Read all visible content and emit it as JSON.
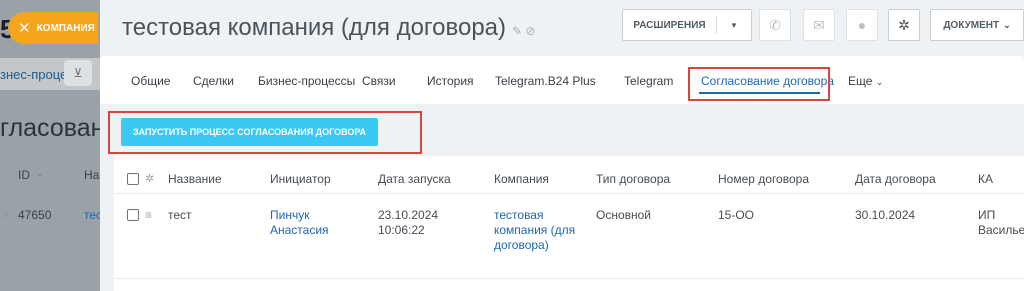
{
  "background": {
    "logo_num": "5",
    "company_chip": "КОМПАНИЯ",
    "process_label": "знес-процесс",
    "heading": "гласование",
    "table_head_id": "ID",
    "table_head_name": "На",
    "row_id": "47650",
    "row_name": "тес"
  },
  "header": {
    "title": "тестовая компания (для договора)",
    "extensions_label": "РАСШИРЕНИЯ",
    "document_label": "ДОКУМЕНТ"
  },
  "tabs": [
    {
      "label": "Общие"
    },
    {
      "label": "Сделки"
    },
    {
      "label": "Бизнес-процессы"
    },
    {
      "label": "Связи"
    },
    {
      "label": "История"
    },
    {
      "label": "Telegram.B24 Plus"
    },
    {
      "label": "Telegram"
    },
    {
      "label": "Согласование договора"
    },
    {
      "label": "Еще"
    }
  ],
  "actions": {
    "start_process": "ЗАПУСТИТЬ ПРОЦЕСС СОГЛАСОВАНИЯ ДОГОВОРА"
  },
  "table": {
    "columns": [
      "Название",
      "Инициатор",
      "Дата запуска",
      "Компания",
      "Тип договора",
      "Номер договора",
      "Дата договора",
      "КА"
    ],
    "row": {
      "name": "тест",
      "initiator_1": "Пинчук",
      "initiator_2": "Анастасия",
      "start_date": "23.10.2024",
      "start_time": "10:06:22",
      "company_1": "тестовая",
      "company_2": "компания (для",
      "company_3": "договора)",
      "contract_type": "Основной",
      "contract_number": "15-ОО",
      "contract_date": "30.10.2024",
      "ka_1": "ИП",
      "ka_2": "Василье"
    }
  },
  "colors": {
    "accent_blue": "#2067b0",
    "start_button": "#3bc8f5",
    "highlight_red": "#d8453b",
    "company_chip": "#f4a51c"
  }
}
